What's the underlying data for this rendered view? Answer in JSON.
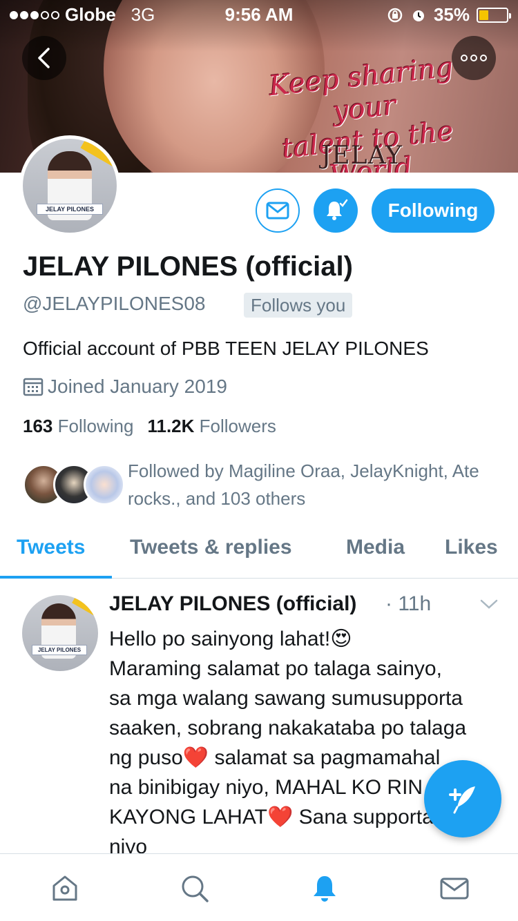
{
  "status_bar": {
    "carrier": "Globe",
    "network": "3G",
    "time": "9:56 AM",
    "battery_percent": "35%",
    "battery_level": 0.35,
    "signal_bars_filled": 3,
    "signal_bars_total": 5
  },
  "banner": {
    "text_line1": "Keep sharing your",
    "text_line2": "talent to the World",
    "signature": "JELAY"
  },
  "avatar": {
    "label": "JELAY PILONES"
  },
  "actions": {
    "following_label": "Following"
  },
  "profile": {
    "display_name": "JELAY PILONES (official)",
    "handle": "@JELAYPILONES08",
    "follows_you": "Follows you",
    "bio": "Official account of PBB TEEN JELAY PILONES",
    "joined": "Joined January 2019",
    "following_count": "163",
    "following_label": "Following",
    "followers_count": "11.2K",
    "followers_label": "Followers",
    "followed_by": "Followed by Magiline Oraa, JelayKnight, Ate rocks., and 103 others"
  },
  "tabs": [
    {
      "label": "Tweets",
      "active": true
    },
    {
      "label": "Tweets & replies",
      "active": false
    },
    {
      "label": "Media",
      "active": false
    },
    {
      "label": "Likes",
      "active": false
    }
  ],
  "tweet": {
    "author": "JELAY PILONES (official)",
    "time": "· 11h",
    "body": "Hello po sainyong lahat!😍\nMaraming salamat po talaga sainyo, sa mga walang sawang sumusupporta saaken, sobrang nakakataba po talaga ng puso❤️ salamat sa pagmamahal na binibigay niyo, MAHAL KO RIN PO KAYONG LAHAT❤️ Sana supportahan niyo"
  },
  "bottom_nav": [
    "home-icon",
    "search-icon",
    "notifications-icon",
    "messages-icon"
  ],
  "colors": {
    "accent": "#1da1f2",
    "text_primary": "#14171a",
    "text_secondary": "#657786"
  }
}
